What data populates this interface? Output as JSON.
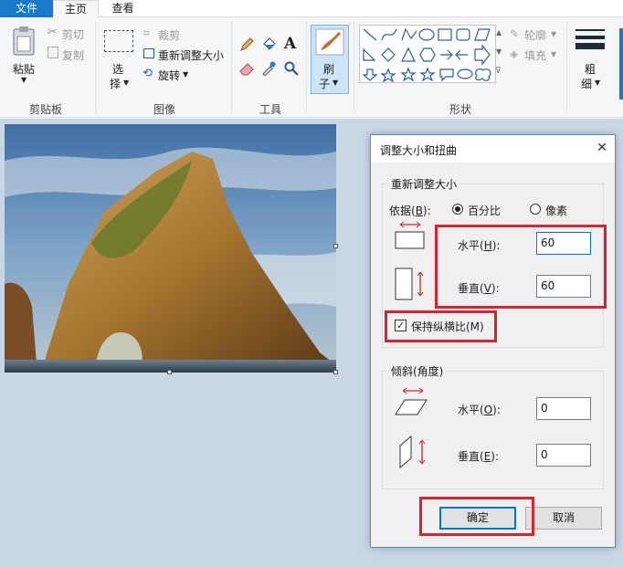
{
  "tabs": {
    "file": "文件",
    "home": "主页",
    "view": "查看"
  },
  "groups": {
    "clipboard": {
      "label": "剪贴板",
      "paste": "粘贴",
      "cut": "剪切",
      "copy": "复制"
    },
    "image": {
      "label": "图像",
      "select_1": "选",
      "select_2": "择",
      "crop": "裁剪",
      "resize": "重新调整大小",
      "rotate": "旋转"
    },
    "tools": {
      "label": "工具",
      "text_icon": "A"
    },
    "brush": {
      "label_1": "刷",
      "label_2": "子"
    },
    "shapes": {
      "label": "形状",
      "outline": "轮廓",
      "fill": "填充"
    },
    "size": {
      "label_1": "粗",
      "label_2": "细"
    }
  },
  "dialog": {
    "title": "调整大小和扭曲",
    "close": "✕",
    "resize_legend": "重新调整大小",
    "by_label": "依据(",
    "by_key": "B",
    "by_suffix": "):",
    "percent": "百分比",
    "pixels": "像素",
    "horizontal_label": "水平(",
    "horizontal_key": "H",
    "horizontal_suffix": "):",
    "horizontal_value": "60",
    "vertical_label": "垂直(",
    "vertical_key": "V",
    "vertical_suffix": "):",
    "vertical_value": "60",
    "keep_ratio": "保持纵横比(M)",
    "skew_legend": "倾斜(角度)",
    "skew_h_label": "水平(",
    "skew_h_key": "O",
    "skew_h_suffix": "):",
    "skew_h_value": "0",
    "skew_v_label": "垂直(",
    "skew_v_key": "E",
    "skew_v_suffix": "):",
    "skew_v_value": "0",
    "ok": "确定",
    "cancel": "取消"
  },
  "colors": {
    "accent": "#1979ca",
    "highlight": "#d9232e",
    "canvas_bg": "#c9d6e6"
  }
}
